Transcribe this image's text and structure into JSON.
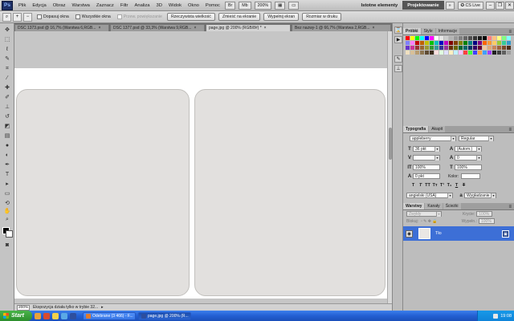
{
  "app": {
    "logo": "Ps",
    "menu": [
      "Plik",
      "Edycja",
      "Obraz",
      "Warstwa",
      "Zaznacz",
      "Filtr",
      "Analiza",
      "3D",
      "Widok",
      "Okno",
      "Pomoc"
    ],
    "zoom_control": "200%",
    "workspace_essentials": "Istotne elementy",
    "workspace_design": "Projektowanie",
    "cs_live": "CS Live"
  },
  "options_bar": {
    "fit_windows": "Dopasuj okna",
    "all_windows": "Wszystkie okna",
    "scrubby_zoom": "Przew. powiększanie",
    "actual_pixels": "Rzeczywista wielkość",
    "fit_screen": "Zmieść na ekranie",
    "fill_screen": "Wypełnij ekran",
    "print_size": "Rozmiar w druku"
  },
  "tabs": [
    {
      "label": "DSC 1373.psd @ 16,7% (Warstwa 6,RGB...",
      "active": false
    },
    {
      "label": "DSC 1377.psd @ 33,3% (Warstwa 9,RGB...",
      "active": false
    },
    {
      "label": "page.jpg @ 200% (RGB/8#) *",
      "active": true
    },
    {
      "label": "Bez nazwy-1 @ 66,7% (Warstwa 2,RGB...",
      "active": false
    }
  ],
  "status": {
    "zoom": "200%",
    "message": "Ekspozycja działa tylko w trybie 32..."
  },
  "swatches_panel": {
    "tabs": [
      "Próbki",
      "Style",
      "Informacje"
    ],
    "colors": [
      "#ff0000",
      "#ffff00",
      "#00ff00",
      "#00ffff",
      "#0000ff",
      "#ff00ff",
      "#ffffff",
      "#e6e6e6",
      "#cccccc",
      "#b3b3b3",
      "#999999",
      "#808080",
      "#666666",
      "#4d4d4d",
      "#333333",
      "#1a1a1a",
      "#000000",
      "#ff8080",
      "#ffc080",
      "#ffff80",
      "#80ff80",
      "#80ffff",
      "#8080ff",
      "#ff80ff",
      "#c00000",
      "#c06000",
      "#c0c000",
      "#00c000",
      "#00c0c0",
      "#0000c0",
      "#c000c0",
      "#800000",
      "#804000",
      "#808000",
      "#008000",
      "#008080",
      "#000080",
      "#800080",
      "#ff6600",
      "#ff9933",
      "#ffcc66",
      "#99cc33",
      "#33cc99",
      "#3399cc",
      "#6633cc",
      "#cc3399",
      "#993333",
      "#996633",
      "#999933",
      "#339933",
      "#339999",
      "#333399",
      "#993399",
      "#663300",
      "#666600",
      "#006633",
      "#006666",
      "#003366",
      "#330066",
      "#660033",
      "#f2c9a0",
      "#e0a878",
      "#c8865a",
      "#a0643c",
      "#7a4a2a",
      "#4e2e1a",
      "#f0e0c0",
      "#d8c098",
      "#b89c70",
      "#8c7450",
      "#604c34",
      "#3c2c1c",
      "#ffe0e0",
      "#e0ffe0",
      "#e0e0ff",
      "#fff0c0",
      "#c0f0ff",
      "#f0c0ff",
      "#ff4040",
      "#40ff40",
      "#4040ff",
      "#ffa040",
      "#40a0ff",
      "#a040ff",
      "#202020",
      "#404040",
      "#606060",
      "#a0a0a0"
    ]
  },
  "character_panel": {
    "tabs": [
      "Typografia",
      "Akapit"
    ],
    "font_family": "appleberry",
    "font_style": "Regular",
    "font_size": "36 pkt",
    "leading": "(Autom.)",
    "tracking": "",
    "kerning": "",
    "kerning_value": "0",
    "vertical_scale": "100%",
    "horizontal_scale": "100%",
    "baseline_shift": "0 pkt",
    "color_label": "Kolor:",
    "type_buttons": [
      "T",
      "T",
      "TT",
      "Tт",
      "T¹",
      "T₁",
      "T",
      "T"
    ],
    "language": "angielski (USA)",
    "antialias": "Wygładzanie"
  },
  "layers_panel": {
    "tabs": [
      "Warstwy",
      "Kanały",
      "Ścieżki"
    ],
    "blend_mode": "Zwykły",
    "opacity_label": "Krycie:",
    "opacity": "100%",
    "lock_label": "Blokuj:",
    "fill_label": "Wypełn.:",
    "fill": "100%",
    "layers": [
      {
        "name": "Tło",
        "visible": true,
        "locked": true
      }
    ]
  },
  "taskbar": {
    "start": "Start",
    "windows": [
      {
        "label": "Odebrane (3 466) - F...",
        "active": false
      },
      {
        "label": "page.jpg @ 200% (R...",
        "active": true
      }
    ],
    "clock": "19:08"
  }
}
